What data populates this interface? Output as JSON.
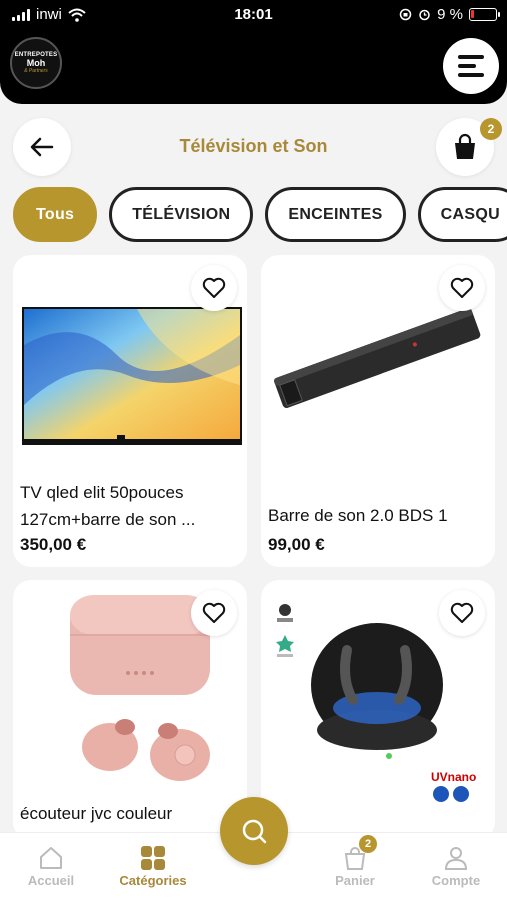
{
  "status_bar": {
    "carrier": "inwi",
    "time": "18:01",
    "battery": "9 %"
  },
  "header": {
    "logo_line1": "ENTREPOTES",
    "logo_line2": "Moh",
    "logo_line3": "& Partners"
  },
  "title": "Télévision et Son",
  "cart_count": "2",
  "categories": [
    {
      "label": "Tous",
      "active": true
    },
    {
      "label": "TÉLÉVISION"
    },
    {
      "label": "ENCEINTES"
    },
    {
      "label": "CASQU"
    }
  ],
  "products": [
    {
      "name": "TV qled elit 50pouces 127cm+barre de son ...",
      "price": "350,00 €"
    },
    {
      "name": "Barre de son 2.0 BDS 1",
      "price": "99,00 €"
    },
    {
      "name": "écouteur jvc couleur",
      "price": ""
    },
    {
      "name": "",
      "price": ""
    }
  ],
  "product4_brand": "UVnano",
  "nav": {
    "home": "Accueil",
    "categories": "Catégories",
    "cart": "Panier",
    "cart_badge": "2",
    "account": "Compte"
  },
  "colors": {
    "accent": "#b8962e",
    "title": "#a8893a",
    "header_bg": "#000000"
  }
}
